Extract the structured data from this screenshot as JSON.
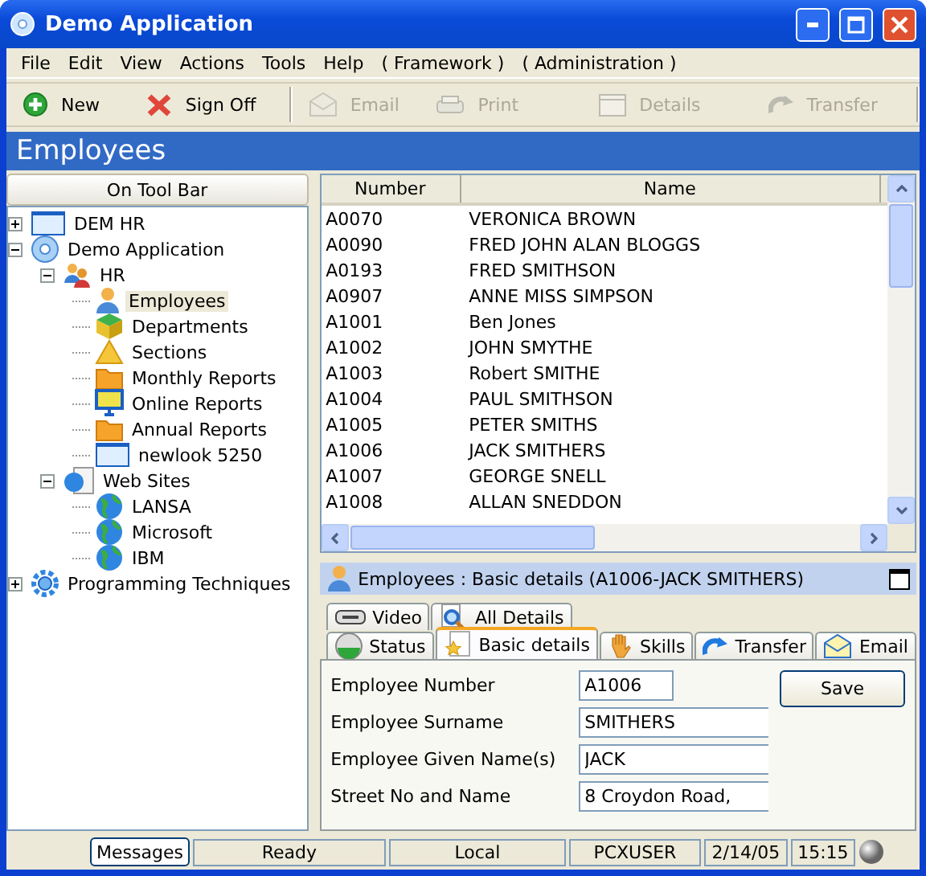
{
  "window": {
    "title": "Demo Application"
  },
  "menu": [
    {
      "label": "File"
    },
    {
      "label": "Edit"
    },
    {
      "label": "View"
    },
    {
      "label": "Actions"
    },
    {
      "label": "Tools"
    },
    {
      "label": "Help"
    },
    {
      "label": "( Framework )"
    },
    {
      "label": "( Administration )"
    }
  ],
  "toolbar": [
    {
      "label": "New",
      "kind": "new",
      "disabled": false
    },
    {
      "label": "Sign Off",
      "kind": "signoff",
      "disabled": false
    },
    {
      "label": "Email",
      "kind": "email",
      "disabled": true
    },
    {
      "label": "Print",
      "kind": "print",
      "disabled": true
    },
    {
      "label": "Details",
      "kind": "details",
      "disabled": true
    },
    {
      "label": "Transfer",
      "kind": "transfer",
      "disabled": true
    }
  ],
  "header": {
    "title": "Employees"
  },
  "sidebar": {
    "title": "On Tool Bar",
    "tree": [
      {
        "label": "DEM HR",
        "kind": "window",
        "expanded": false,
        "selected": false
      },
      {
        "label": "Demo Application",
        "kind": "disc",
        "expanded": true,
        "selected": false,
        "children": [
          {
            "label": "HR",
            "kind": "people",
            "expanded": true,
            "selected": false,
            "children": [
              {
                "label": "Employees",
                "kind": "person",
                "selected": true
              },
              {
                "label": "Departments",
                "kind": "box",
                "selected": false
              },
              {
                "label": "Sections",
                "kind": "triangle",
                "selected": false
              },
              {
                "label": "Monthly Reports",
                "kind": "folder",
                "selected": false
              },
              {
                "label": "Online Reports",
                "kind": "monitor",
                "selected": false
              },
              {
                "label": "Annual Reports",
                "kind": "folder",
                "selected": false
              },
              {
                "label": "newlook 5250",
                "kind": "window",
                "selected": false
              }
            ]
          },
          {
            "label": "Web Sites",
            "kind": "webpage",
            "expanded": true,
            "selected": false,
            "children": [
              {
                "label": "LANSA",
                "kind": "globe",
                "selected": false
              },
              {
                "label": "Microsoft",
                "kind": "globe",
                "selected": false
              },
              {
                "label": "IBM",
                "kind": "globe",
                "selected": false
              }
            ]
          }
        ]
      },
      {
        "label": "Programming Techniques",
        "kind": "gear",
        "expanded": false,
        "selected": false
      }
    ]
  },
  "table": {
    "columns": [
      "Number",
      "Name"
    ],
    "rows": [
      [
        "A0070",
        "VERONICA BROWN"
      ],
      [
        "A0090",
        "FRED JOHN ALAN BLOGGS"
      ],
      [
        "A0193",
        "FRED SMITHSON"
      ],
      [
        "A0907",
        "ANNE MISS SIMPSON"
      ],
      [
        "A1001",
        "Ben Jones"
      ],
      [
        "A1002",
        "JOHN SMYTHE"
      ],
      [
        "A1003",
        "Robert SMITHE"
      ],
      [
        "A1004",
        "PAUL SMITHSON"
      ],
      [
        "A1005",
        "PETER SMITHS"
      ],
      [
        "A1006",
        "JACK SMITHERS"
      ],
      [
        "A1007",
        "GEORGE SNELL"
      ],
      [
        "A1008",
        "ALLAN SNEDDON"
      ]
    ]
  },
  "detail": {
    "title": "Employees : Basic details (A1006-JACK SMITHERS)",
    "tabs_back": [
      {
        "label": "Video",
        "kind": "video",
        "selected": false
      },
      {
        "label": "All Details",
        "kind": "magnifier",
        "selected": false
      }
    ],
    "tabs_front": [
      {
        "label": "Status",
        "kind": "status",
        "selected": false
      },
      {
        "label": "Basic details",
        "kind": "star",
        "selected": true
      },
      {
        "label": "Skills",
        "kind": "hand",
        "selected": false
      },
      {
        "label": "Transfer",
        "kind": "transfer",
        "selected": false
      },
      {
        "label": "Email",
        "kind": "email",
        "selected": false
      }
    ],
    "fields": [
      {
        "label": "Employee Number",
        "value": "A1006",
        "kind": "short"
      },
      {
        "label": "Employee Surname",
        "value": "SMITHERS",
        "kind": "long"
      },
      {
        "label": "Employee Given Name(s)",
        "value": "JACK",
        "kind": "long"
      },
      {
        "label": "Street No and Name",
        "value": "8 Croydon Road,",
        "kind": "long"
      }
    ],
    "save_button": "Save"
  },
  "status_bar": {
    "button": "Messages",
    "panes": [
      "Ready",
      "Local",
      "PCXUSER",
      "2/14/05",
      "15:15"
    ]
  }
}
